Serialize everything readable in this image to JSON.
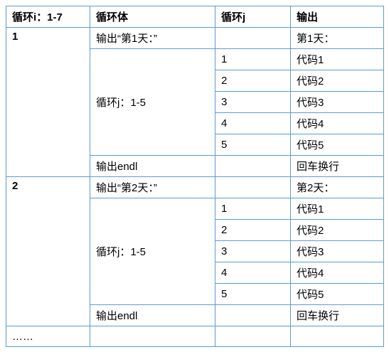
{
  "headers": {
    "col1": "循环i：1-7",
    "col2": "循环体",
    "col3": "循环j",
    "col4": "输出"
  },
  "blocks": [
    {
      "i": "1",
      "day_body": "输出“第1天：”",
      "day_out": "第1天：",
      "inner_label": "循环j：1-5",
      "inner": [
        {
          "j": "1",
          "out": "代码1"
        },
        {
          "j": "2",
          "out": "代码2"
        },
        {
          "j": "3",
          "out": "代码3"
        },
        {
          "j": "4",
          "out": "代码4"
        },
        {
          "j": "5",
          "out": "代码5"
        }
      ],
      "endl_body": "输出endl",
      "endl_out": "回车换行"
    },
    {
      "i": "2",
      "day_body": "输出“第2天：”",
      "day_out": "第2天：",
      "inner_label": "循环j：1-5",
      "inner": [
        {
          "j": "1",
          "out": "代码1"
        },
        {
          "j": "2",
          "out": "代码2"
        },
        {
          "j": "3",
          "out": "代码3"
        },
        {
          "j": "4",
          "out": "代码4"
        },
        {
          "j": "5",
          "out": "代码5"
        }
      ],
      "endl_body": "输出endl",
      "endl_out": "回车换行"
    }
  ],
  "ellipsis": "……"
}
